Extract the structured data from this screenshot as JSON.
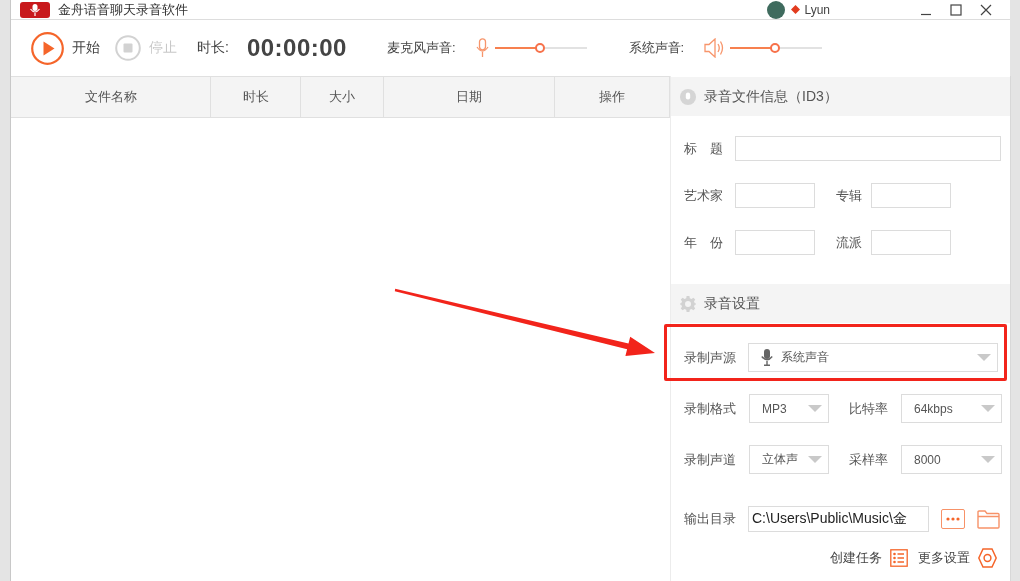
{
  "window": {
    "title": "金舟语音聊天录音软件",
    "user": "Lyun"
  },
  "toolbar": {
    "start": {
      "label": "开始",
      "disabled": false
    },
    "stop": {
      "label": "停止",
      "disabled": true
    },
    "duration_label": "时长:",
    "duration": "00:00:00",
    "mic": {
      "label": "麦克风声音:",
      "level": 0.49
    },
    "system": {
      "label": "系统声音:",
      "level": 0.49
    }
  },
  "table": {
    "columns": [
      "文件名称",
      "时长",
      "大小",
      "日期",
      "操作"
    ]
  },
  "id3": {
    "title": "录音文件信息（ID3）",
    "rows": [
      [
        {
          "label": "标　题"
        }
      ],
      [
        {
          "label": "艺术家"
        },
        {
          "label": "专辑"
        }
      ],
      [
        {
          "label": "年　份"
        },
        {
          "label": "流派"
        }
      ]
    ]
  },
  "settings": {
    "title": "录音设置",
    "source": {
      "label": "录制声源",
      "value": "系统声音",
      "highlighted": true
    },
    "rows": [
      [
        {
          "label": "录制格式",
          "value": "MP3"
        },
        {
          "label": "比特率",
          "value": "64kbps"
        }
      ],
      [
        {
          "label": "录制声道",
          "value": "立体声"
        },
        {
          "label": "采样率",
          "value": "8000"
        }
      ]
    ],
    "output": {
      "label": "输出目录",
      "value": "C:\\Users\\Public\\Music\\金"
    }
  },
  "actions": [
    {
      "label": "创建任务",
      "kind": "tasks"
    },
    {
      "label": "更多设置",
      "kind": "more"
    }
  ]
}
